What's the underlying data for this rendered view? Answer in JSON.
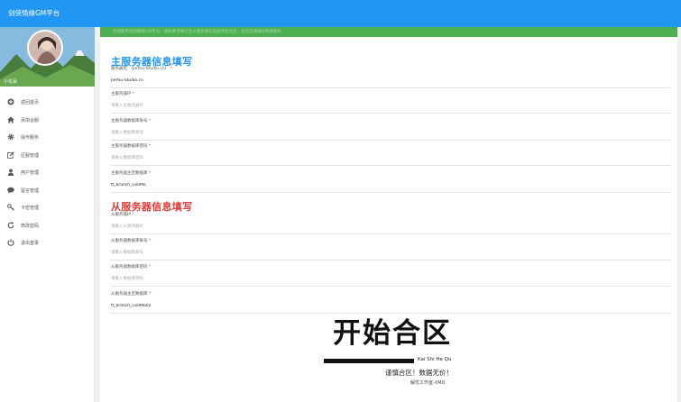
{
  "app": {
    "title": "剑侠情缘GM平台"
  },
  "profile": {
    "username": "小花朵"
  },
  "menu": [
    {
      "label": "返回首页",
      "icon": "plus-circle-icon"
    },
    {
      "label": "添加合服",
      "icon": "home-icon"
    },
    {
      "label": "操作服务",
      "icon": "gear-icon"
    },
    {
      "label": "区服管理",
      "icon": "edit-icon"
    },
    {
      "label": "用户管理",
      "icon": "user-icon"
    },
    {
      "label": "留言管理",
      "icon": "chat-icon"
    },
    {
      "label": "卡密管理",
      "icon": "key-icon"
    },
    {
      "label": "修改密码",
      "icon": "refresh-icon"
    },
    {
      "label": "退出登录",
      "icon": "power-icon"
    }
  ],
  "notice": "欢迎使用剑侠情缘GM平台 · 请按要求填写主从服务器信息后开始合区 · 合区前请做好数据备份",
  "main_server": {
    "title": "主服务器信息填写",
    "fields": [
      {
        "label": "服务器名",
        "hint": "（JieYou-Studio.cn）",
        "required": true,
        "value": "JieYou-Studio.cn",
        "placeholder": ""
      },
      {
        "label": "主服务器IP",
        "hint": "",
        "required": true,
        "value": "",
        "placeholder": "请输入主服务器IP"
      },
      {
        "label": "主服务器数据库账号",
        "hint": "",
        "required": true,
        "value": "",
        "placeholder": "请输入数据库账号"
      },
      {
        "label": "主服务器数据库密码",
        "hint": "",
        "required": true,
        "value": "",
        "placeholder": "请输入数据库密码"
      },
      {
        "label": "主服务器主区数据库",
        "hint": "",
        "required": true,
        "value": "ft_branch_Gs0Mo",
        "placeholder": ""
      }
    ]
  },
  "slave_server": {
    "title": "从服务器信息填写",
    "fields": [
      {
        "label": "从服务器IP",
        "hint": "",
        "required": true,
        "value": "",
        "placeholder": "请输入从服务器IP"
      },
      {
        "label": "从服务器数据库账号",
        "hint": "",
        "required": true,
        "value": "",
        "placeholder": "请输入数据库账号"
      },
      {
        "label": "从服务器数据库密码",
        "hint": "",
        "required": true,
        "value": "",
        "placeholder": "请输入数据库密码"
      },
      {
        "label": "从服务器主区数据库",
        "hint": "",
        "required": true,
        "value": "ft_branch_Gs0Mo02",
        "placeholder": ""
      }
    ]
  },
  "start": {
    "button_text": "开始合区",
    "pinyin": "Kai Shi He Qu",
    "slogan": "谨慎合区！数据无价！",
    "credit": "解忧工作室-XMD"
  },
  "colors": {
    "topbar": "#2196f3",
    "notice": "#4caf50",
    "main_title": "#2196f3",
    "sub_title": "#e53935"
  }
}
